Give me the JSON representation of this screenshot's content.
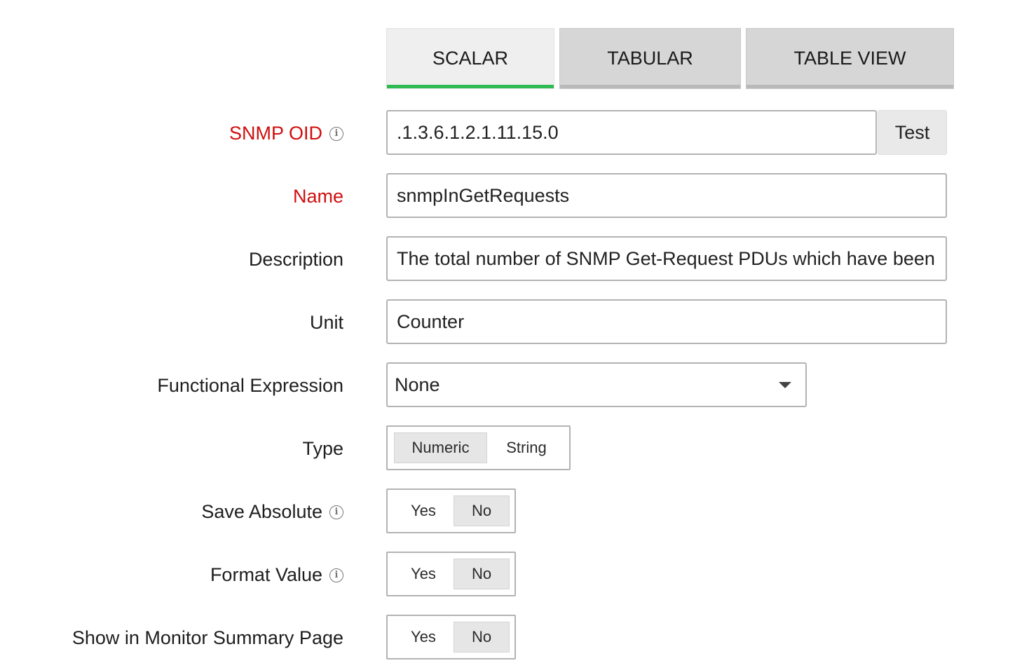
{
  "tabs": [
    {
      "label": "SCALAR",
      "active": true
    },
    {
      "label": "TABULAR",
      "active": false
    },
    {
      "label": "TABLE VIEW",
      "active": false
    }
  ],
  "fields": {
    "snmp_oid": {
      "label": "SNMP OID",
      "value": ".1.3.6.1.2.1.11.15.0",
      "test_label": "Test"
    },
    "name": {
      "label": "Name",
      "value": "snmpInGetRequests"
    },
    "description": {
      "label": "Description",
      "value": "The total number of SNMP Get-Request PDUs which have been"
    },
    "unit": {
      "label": "Unit",
      "value": "Counter"
    },
    "functional_expression": {
      "label": "Functional Expression",
      "selected": "None"
    },
    "type": {
      "label": "Type",
      "options": [
        "Numeric",
        "String"
      ],
      "selected": "Numeric"
    },
    "save_absolute": {
      "label": "Save Absolute",
      "options": [
        "Yes",
        "No"
      ],
      "selected": "No"
    },
    "format_value": {
      "label": "Format Value",
      "options": [
        "Yes",
        "No"
      ],
      "selected": "No"
    },
    "show_in_summary": {
      "label": "Show in Monitor Summary Page",
      "options": [
        "Yes",
        "No"
      ],
      "selected": "No"
    }
  },
  "info_glyph": "i",
  "colors": {
    "active_tab_underline": "#2dbb52",
    "required_label": "#d10f0f"
  }
}
